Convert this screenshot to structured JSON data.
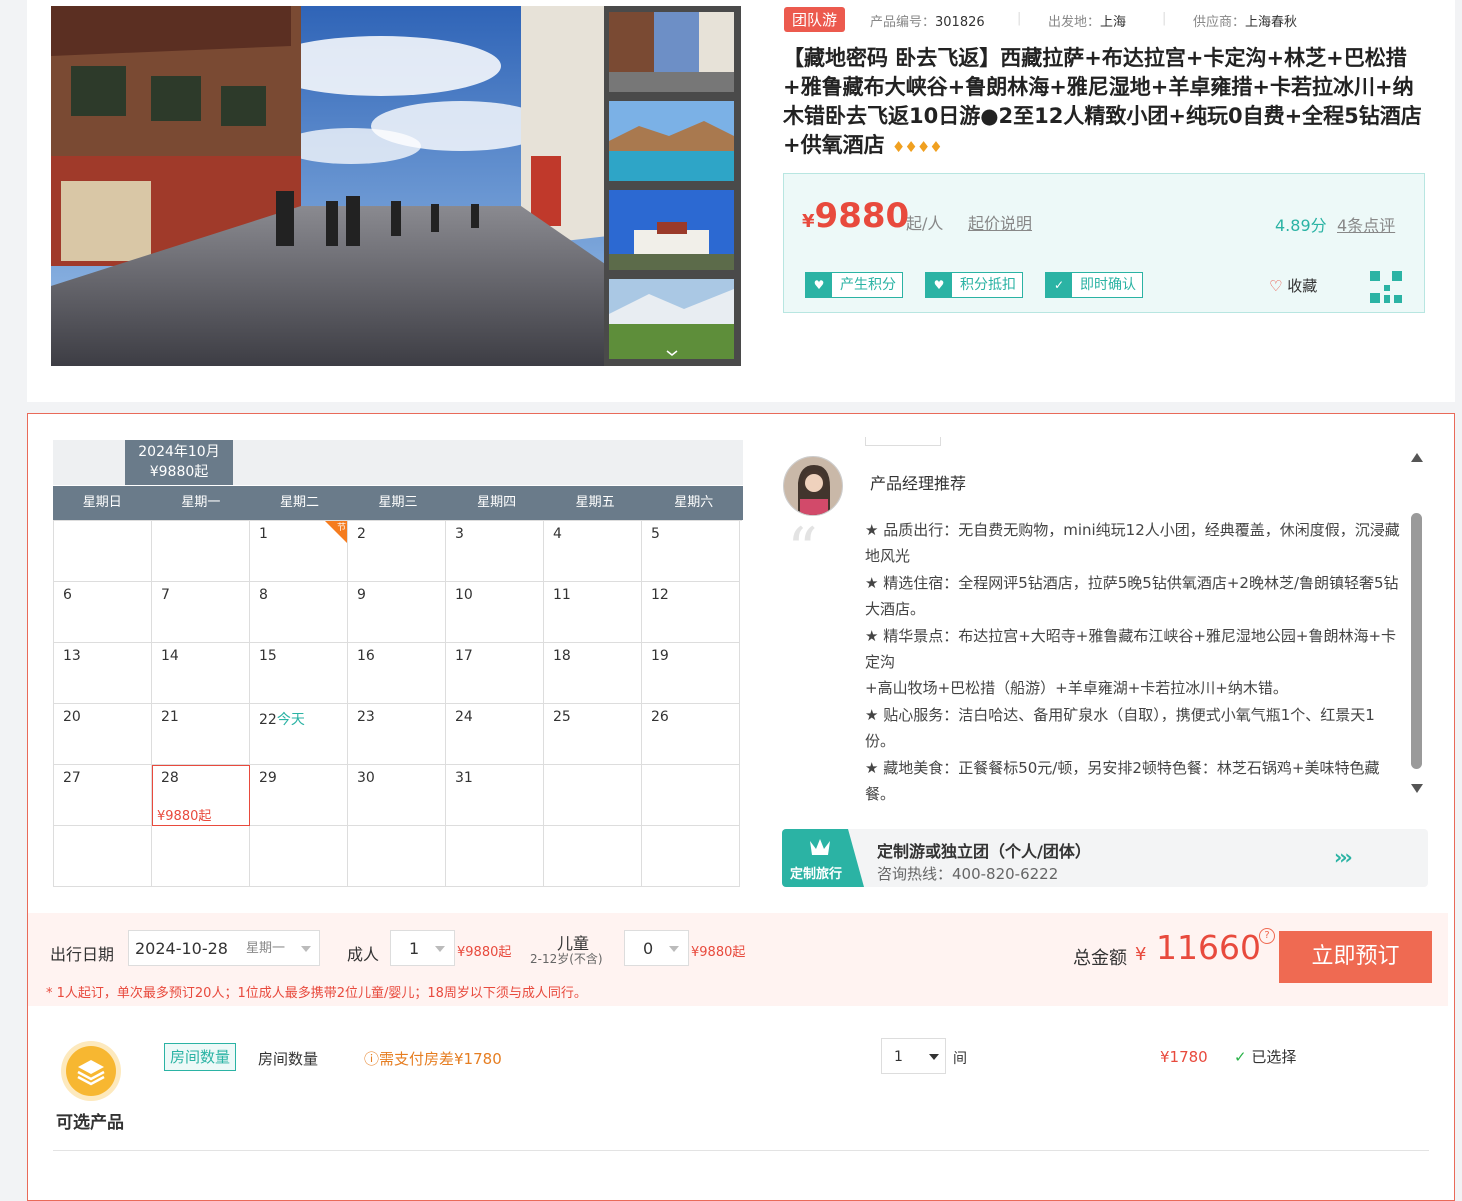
{
  "product": {
    "badge": "团队游",
    "code_label": "产品编号：",
    "code": "301826",
    "depart_label": "出发地：",
    "depart": "上海",
    "supplier_label": "供应商：",
    "supplier": "上海春秋",
    "title": "【藏地密码 卧去飞返】西藏拉萨+布达拉宫+卡定沟+林芝+巴松措+雅鲁藏布大峡谷+鲁朗林海+雅尼湿地+羊卓雍措+卡若拉冰川+纳木错卧去飞返10日游●2至12人精致小团+纯玩0自费+全程5钻酒店+供氧酒店",
    "diamond_rating": 4
  },
  "price_box": {
    "currency": "¥",
    "price": "9880",
    "unit": "起/人",
    "explain": "起价说明",
    "score": "4.89分",
    "reviews": "4条点评",
    "tags": [
      "产生积分",
      "积分抵扣",
      "即时确认"
    ],
    "favorite": "收藏"
  },
  "calendar": {
    "month": "2024年10月",
    "month_price": "¥9880起",
    "weekdays": [
      "星期日",
      "星期一",
      "星期二",
      "星期三",
      "星期四",
      "星期五",
      "星期六"
    ],
    "holiday_mark": "节",
    "today_label": "今天",
    "selected_price": "¥9880起"
  },
  "recommend": {
    "title": "产品经理推荐",
    "lines": [
      "★ 品质出行：无自费无购物，mini纯玩12人小团，经典覆盖，休闲度假，沉浸藏地风光",
      "★ 精选住宿：全程网评5钻酒店，拉萨5晚5钻供氧酒店+2晚林芝/鲁朗镇轻奢5钻大酒店。",
      "★ 精华景点：布达拉宫+大昭寺+雅鲁藏布江峡谷+雅尼湿地公园+鲁朗林海+卡定沟",
      "+高山牧场+巴松措（船游）+羊卓雍湖+卡若拉冰川+纳木错。",
      "★ 贴心服务：洁白哈达、备用矿泉水（自取），携便式小氧气瓶1个、红景天1份。",
      "★ 藏地美食：正餐餐标50元/顿，另安排2顿特色餐：林芝石锅鸡+美味特色藏餐。"
    ]
  },
  "custom": {
    "badge": "定制旅行",
    "title": "定制游或独立团（个人/团体）",
    "hotline": "咨询热线：400-820-6222"
  },
  "order": {
    "date_label": "出行日期",
    "date": "2024-10-28",
    "weekday": "星期一",
    "adult_label": "成人",
    "adult_count": "1",
    "adult_price": "¥9880起",
    "child_label": "儿童",
    "child_sub": "2-12岁(不含)",
    "child_count": "0",
    "child_price": "¥9880起",
    "total_label": "总金额",
    "total_currency": "¥",
    "total": "11660",
    "book": "立即预订",
    "note": "* 1人起订，单次最多预订20人；1位成人最多携带2位儿童/婴儿；18周岁以下须与成人同行。"
  },
  "optional": {
    "label": "可选产品",
    "tag": "房间数量",
    "name": "房间数量",
    "warn": "需支付房差¥1780",
    "qty": "1",
    "unit": "间",
    "price": "¥1780",
    "status": "已选择"
  },
  "colors": {
    "accent": "#2bb3a4",
    "price": "#e84a3d",
    "book": "#ef6a52"
  }
}
